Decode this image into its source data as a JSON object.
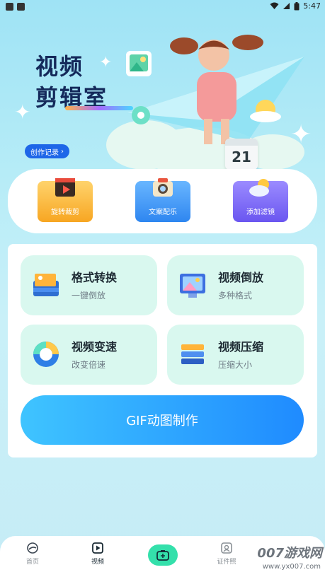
{
  "status_bar": {
    "time": "5:47"
  },
  "banner": {
    "title_line1": "视频",
    "title_line2": "剪辑室",
    "record_label": "创作记录",
    "calendar_day": "21"
  },
  "quick_actions": [
    {
      "label": "旋转裁剪",
      "icon": "film-clapper-icon"
    },
    {
      "label": "文案配乐",
      "icon": "camera-icon"
    },
    {
      "label": "添加滤镜",
      "icon": "weather-cloud-icon"
    }
  ],
  "tools": [
    {
      "title": "格式转换",
      "subtitle": "一键倒放",
      "icon": "format-convert-icon"
    },
    {
      "title": "视频倒放",
      "subtitle": "多种格式",
      "icon": "image-reverse-icon"
    },
    {
      "title": "视频变速",
      "subtitle": "改变倍速",
      "icon": "speed-dial-icon"
    },
    {
      "title": "视频压缩",
      "subtitle": "压缩大小",
      "icon": "compress-layers-icon"
    }
  ],
  "gif_button": "GIF动图制作",
  "tabbar": {
    "home": "首页",
    "video": "视频",
    "id_photo": "证件照"
  },
  "watermark": {
    "brand": "007游戏网",
    "url": "www.yx007.com"
  },
  "colors": {
    "accent": "#1f8bff",
    "tool_bg": "#d9f8ef",
    "camera_button": "#34e0ab"
  }
}
